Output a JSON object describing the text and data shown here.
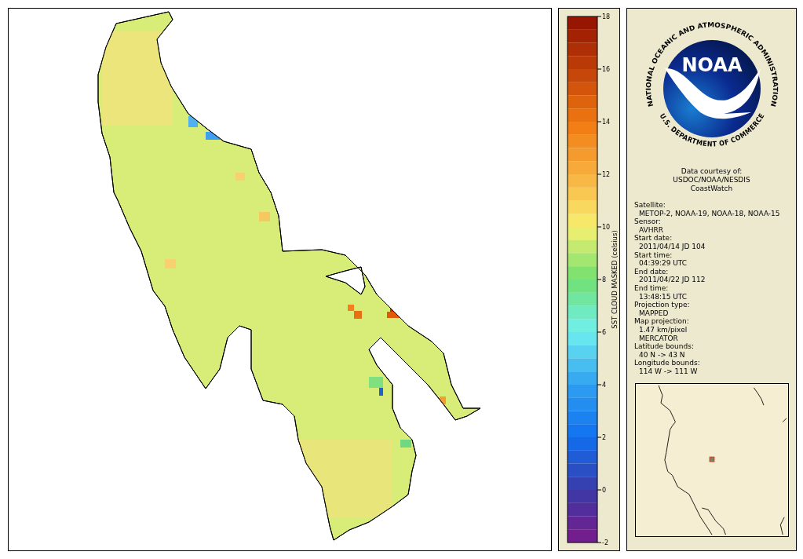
{
  "colorbar": {
    "title": "SST CLOUD MASKED (celsius)",
    "ticks": [
      "18",
      "16",
      "14",
      "12",
      "10",
      "8",
      "6",
      "4",
      "2",
      "0",
      "-2"
    ]
  },
  "logo": {
    "name": "NOAA",
    "ring_top": "NATIONAL OCEANIC AND ATMOSPHERIC ADMINISTRATION",
    "ring_bottom": "U.S. DEPARTMENT OF COMMERCE"
  },
  "courtesy": [
    "Data courtesy of:",
    "USDOC/NOAA/NESDIS",
    "CoastWatch"
  ],
  "fields": [
    {
      "label": "Satellite:",
      "values": [
        "METOP-2, NOAA-19, NOAA-18, NOAA-15"
      ]
    },
    {
      "label": "Sensor:",
      "values": [
        "AVHRR"
      ]
    },
    {
      "label": "Start date:",
      "values": [
        "2011/04/14 JD 104"
      ]
    },
    {
      "label": "Start time:",
      "values": [
        "04:39:29 UTC"
      ]
    },
    {
      "label": "End date:",
      "values": [
        "2011/04/22 JD 112"
      ]
    },
    {
      "label": "End time:",
      "values": [
        "13:48:15 UTC"
      ]
    },
    {
      "label": "Projection type:",
      "values": [
        "MAPPED"
      ]
    },
    {
      "label": "Map projection:",
      "values": [
        "1.47 km/pixel",
        "MERCATOR"
      ]
    },
    {
      "label": "Latitude bounds:",
      "values": [
        "40 N -> 43 N"
      ]
    },
    {
      "label": "Longitude bounds:",
      "values": [
        "114 W -> 111 W"
      ]
    }
  ]
}
